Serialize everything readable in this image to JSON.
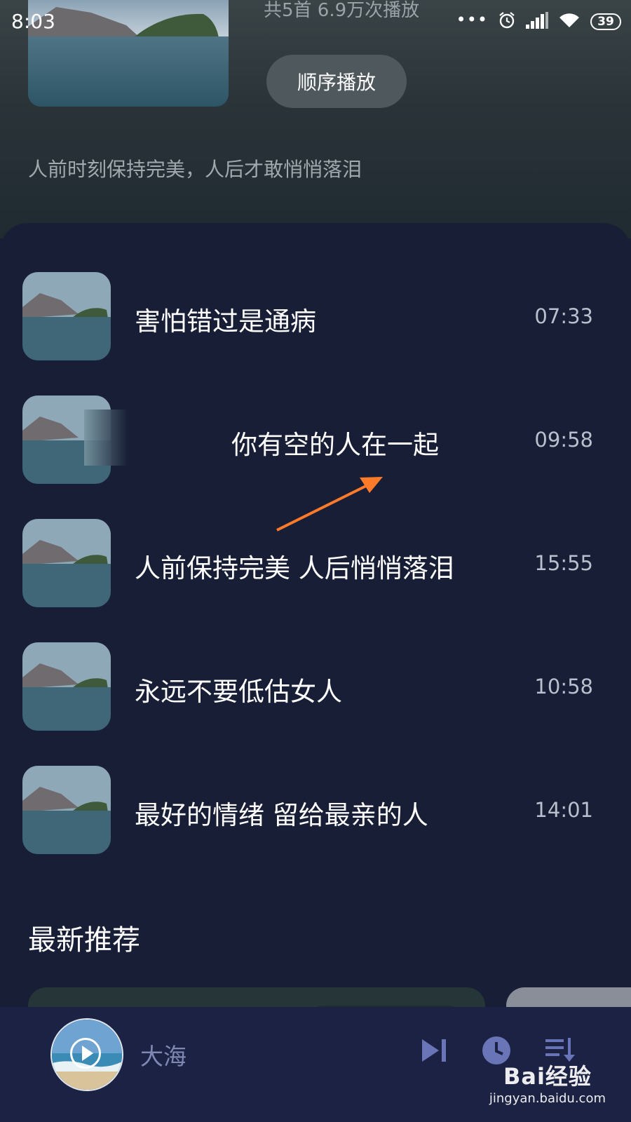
{
  "status_bar": {
    "time": "8:03",
    "dots": "•••",
    "battery": "39"
  },
  "album": {
    "meta": "共5首   6.9万次播放",
    "play_order_label": "顺序播放",
    "description": "人前时刻保持完美，人后才敢悄悄落泪"
  },
  "tracks": [
    {
      "title": "害怕错过是通病",
      "duration": "07:33"
    },
    {
      "title": "你有空的人在一起",
      "duration": "09:58"
    },
    {
      "title": "人前保持完美 人后悄悄落泪",
      "duration": "15:55"
    },
    {
      "title": "永远不要低估女人",
      "duration": "10:58"
    },
    {
      "title": "最好的情绪 留给最亲的人",
      "duration": "14:01"
    }
  ],
  "recommend": {
    "title": "最新推荐"
  },
  "player": {
    "title": "大海"
  },
  "watermark": {
    "logo": "Bai经验",
    "url": "jingyan.baidu.com"
  },
  "colors": {
    "annotation_arrow": "#ff7b2a",
    "panel_bg": "#171e35",
    "player_bg": "#1b2244"
  }
}
